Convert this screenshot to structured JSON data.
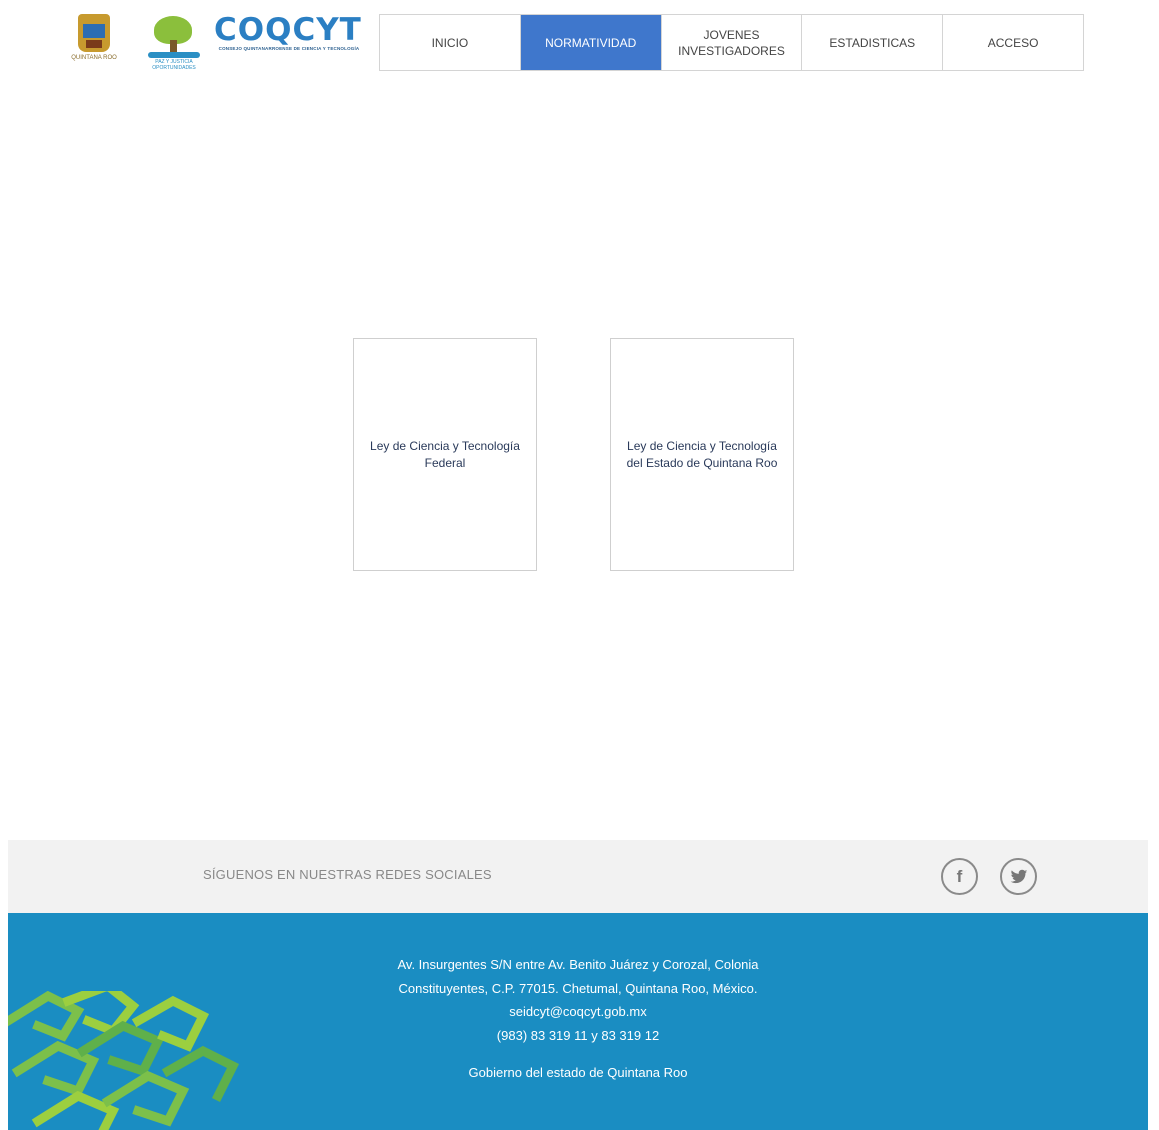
{
  "header": {
    "qroo_logo_text": "QUINTANA ROO",
    "tree_logo_text": "PAZ Y JUSTICIA OPORTUNIDADES",
    "coqcyt_title": "COQCYT",
    "coqcyt_subtitle": "CONSEJO QUINTANARROENSE DE CIENCIA Y TECNOLOGÍA"
  },
  "nav": {
    "items": [
      {
        "label": "INICIO",
        "active": false
      },
      {
        "label": "NORMATIVIDAD",
        "active": true
      },
      {
        "label": "JOVENES INVESTIGADORES",
        "active": false
      },
      {
        "label": "ESTADISTICAS",
        "active": false
      },
      {
        "label": "ACCESO",
        "active": false
      }
    ],
    "active_color": "#3f77cc"
  },
  "cards": [
    {
      "label": "Ley de Ciencia y Tecnología Federal"
    },
    {
      "label": "Ley de Ciencia y Tecnología del Estado de Quintana Roo"
    }
  ],
  "social": {
    "text": "SÍGUENOS EN NUESTRAS REDES SOCIALES",
    "icons": [
      "facebook-icon",
      "twitter-icon"
    ]
  },
  "footer": {
    "address": "Av. Insurgentes S/N entre Av. Benito Juárez y Corozal, Colonia Constituyentes, C.P. 77015. Chetumal, Quintana Roo, México.",
    "email": "seidcyt@coqcyt.gob.mx",
    "phone": "(983) 83 319 11 y 83 319 12",
    "government": "Gobierno del estado de Quintana Roo",
    "background_color": "#1a8dc2"
  }
}
